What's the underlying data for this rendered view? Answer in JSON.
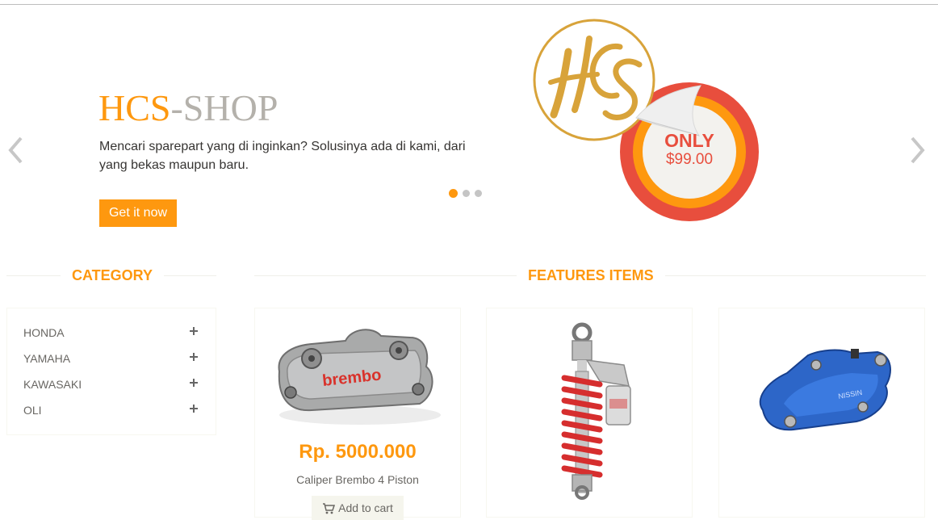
{
  "slider": {
    "brand_part1": "HCS",
    "brand_part2": "-SHOP",
    "tagline": "Mencari sparepart yang di inginkan? Solusinya ada di kami, dari yang bekas maupun baru.",
    "cta_label": "Get it now",
    "logo_text": "HCS",
    "badge_only": "ONLY",
    "badge_price": "$99.00",
    "active_slide": 1,
    "slide_count": 3
  },
  "category": {
    "title": "CATEGORY",
    "items": [
      {
        "label": "HONDA"
      },
      {
        "label": "YAMAHA"
      },
      {
        "label": "KAWASAKI"
      },
      {
        "label": "OLI"
      }
    ]
  },
  "features": {
    "title": "FEATURES ITEMS",
    "products": [
      {
        "price": "Rp. 5000.000",
        "name": "Caliper Brembo 4 Piston",
        "button": "Add to cart"
      },
      {
        "price": "",
        "name": "",
        "button": ""
      },
      {
        "price": "",
        "name": "",
        "button": ""
      }
    ]
  },
  "colors": {
    "accent": "#fe980f",
    "badge_red": "#e84e3d",
    "text": "#696763"
  }
}
